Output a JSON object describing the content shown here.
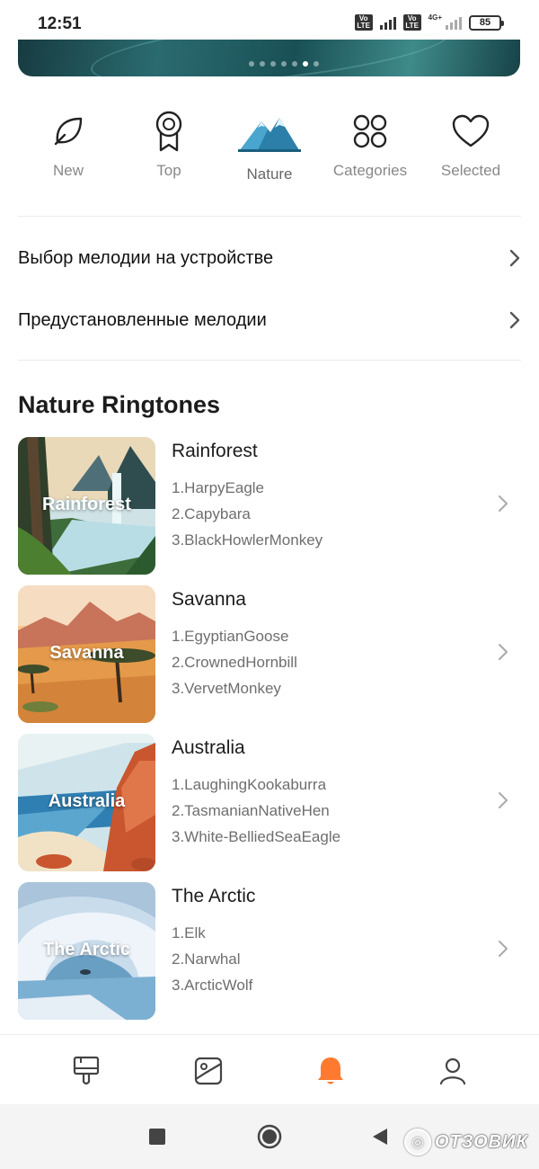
{
  "status_bar": {
    "time": "12:51",
    "sim1": "Vo LTE",
    "sim2": "Vo LTE",
    "network": "4G+",
    "battery": "85"
  },
  "banner": {
    "dots_count": 7,
    "active_dot": 5
  },
  "categories": [
    {
      "label": "New",
      "icon": "leaf-icon"
    },
    {
      "label": "Top",
      "icon": "award-icon"
    },
    {
      "label": "Nature",
      "icon": "mountain-icon",
      "active": true
    },
    {
      "label": "Categories",
      "icon": "grid-icon"
    },
    {
      "label": "Selected",
      "icon": "heart-icon"
    }
  ],
  "menu_rows": [
    {
      "label": "Выбор мелодии на устройстве"
    },
    {
      "label": "Предустановленные мелодии"
    }
  ],
  "section_title": "Nature Ringtones",
  "ringtones": [
    {
      "title": "Rainforest",
      "thumb_label": "Rainforest",
      "tracks": [
        "1.HarpyEagle",
        "2.Capybara",
        "3.BlackHowlerMonkey"
      ]
    },
    {
      "title": "Savanna",
      "thumb_label": "Savanna",
      "tracks": [
        "1.EgyptianGoose",
        "2.CrownedHornbill",
        "3.VervetMonkey"
      ]
    },
    {
      "title": "Australia",
      "thumb_label": "Australia",
      "tracks": [
        "1.LaughingKookaburra",
        "2.TasmanianNativeHen",
        "3.White-BelliedSeaEagle"
      ]
    },
    {
      "title": "The Arctic",
      "thumb_label": "The Arctic",
      "tracks": [
        "1.Elk",
        "2.Narwhal",
        "3.ArcticWolf"
      ]
    }
  ],
  "bottom_nav": [
    {
      "icon": "brush-icon"
    },
    {
      "icon": "wallpaper-icon"
    },
    {
      "icon": "bell-icon",
      "active": true
    },
    {
      "icon": "profile-icon"
    }
  ],
  "colors": {
    "accent": "#ff7a2f",
    "text": "#1c1c1c",
    "muted": "#888888"
  },
  "watermark": "ОТЗОВИК"
}
